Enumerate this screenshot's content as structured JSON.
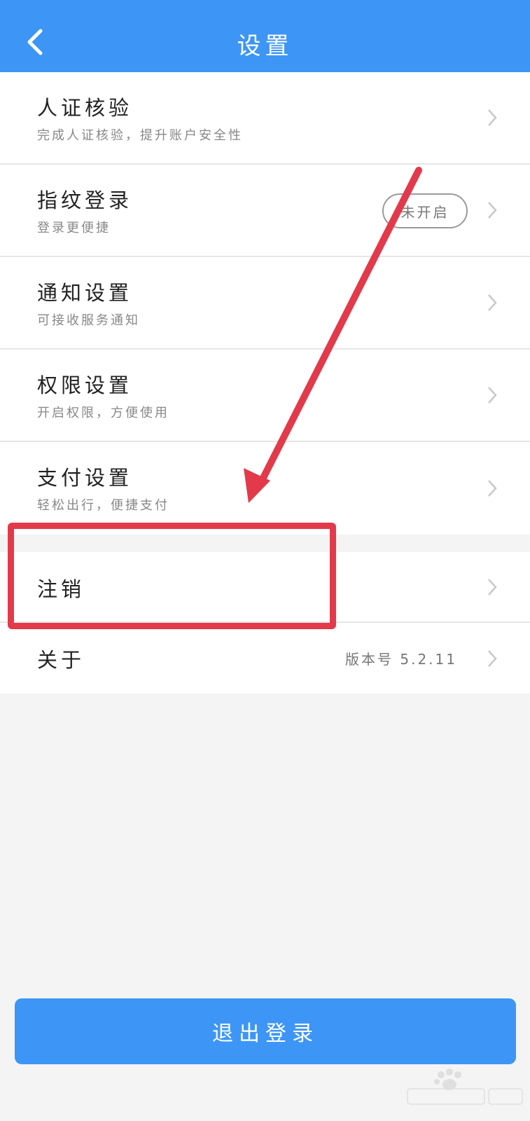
{
  "header": {
    "title": "设置",
    "back_icon": "chevron-left-icon"
  },
  "settings": [
    {
      "title": "人证核验",
      "subtitle": "完成人证核验，提升账户安全性"
    },
    {
      "title": "指纹登录",
      "subtitle": "登录更便捷",
      "status": "未开启"
    },
    {
      "title": "通知设置",
      "subtitle": "可接收服务通知"
    },
    {
      "title": "权限设置",
      "subtitle": "开启权限，方便使用"
    },
    {
      "title": "支付设置",
      "subtitle": "轻松出行，便捷支付"
    }
  ],
  "account": [
    {
      "title": "注销"
    },
    {
      "title": "关于",
      "version": "版本号 5.2.11"
    }
  ],
  "logout_label": "退出登录",
  "colors": {
    "primary": "#3d96f5",
    "annotation": "#e23a4a",
    "background": "#f4f4f4"
  }
}
